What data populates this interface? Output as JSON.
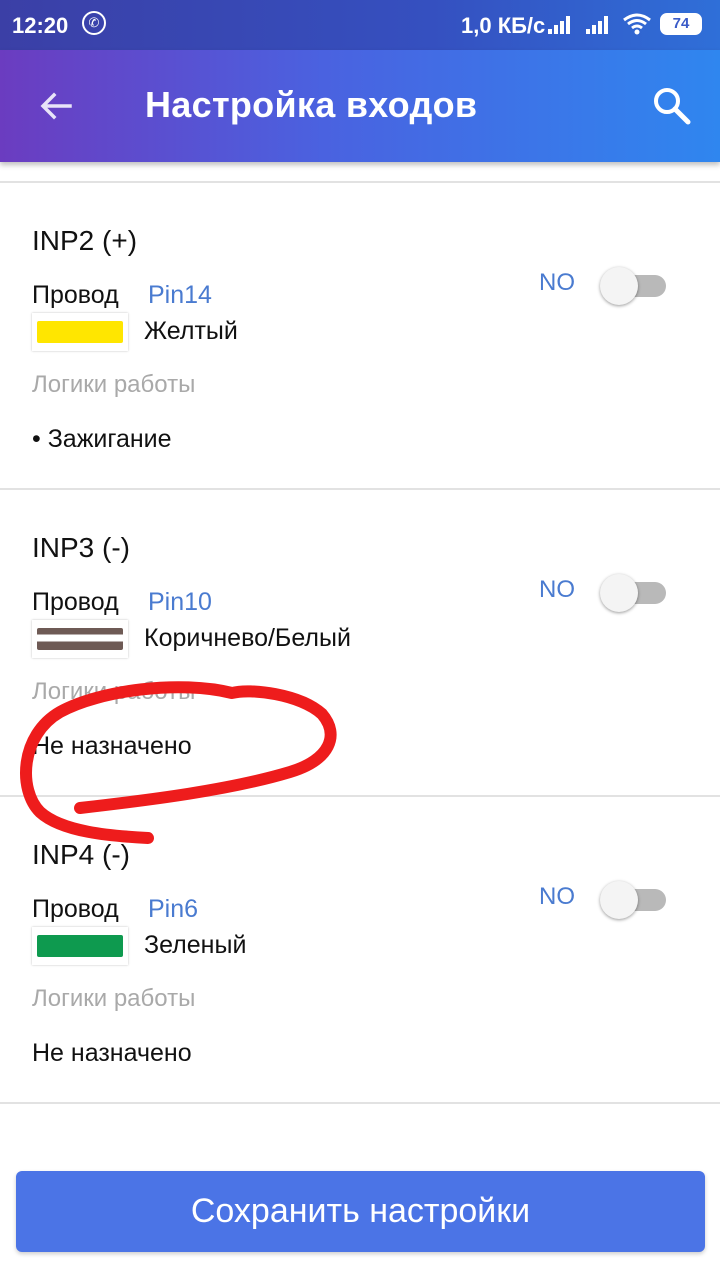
{
  "status_bar": {
    "time": "12:20",
    "network_speed": "1,0 КБ/с",
    "battery": "74",
    "icons": [
      "whatsapp-icon",
      "signal-icon",
      "signal-icon",
      "wifi-icon",
      "battery-icon"
    ]
  },
  "app_bar": {
    "title": "Настройка входов",
    "back_icon": "arrow-back-icon",
    "search_icon": "search-icon",
    "gradient": [
      "#6b3cc0",
      "#2f86ef"
    ]
  },
  "inputs": [
    {
      "title": "INP2 (+)",
      "wire_label": "Провод",
      "pin": "Pin14",
      "color_name": "Желтый",
      "swatch": [
        "#ffe600"
      ],
      "logic_label": "Логики работы",
      "logic_value": "• Зажигание",
      "mode": "NO",
      "enabled": false
    },
    {
      "title": "INP3 (-)",
      "wire_label": "Провод",
      "pin": "Pin10",
      "color_name": "Коричнево/Белый",
      "swatch": [
        "#6e5a55",
        "#ffffff"
      ],
      "logic_label": "Логики работы",
      "logic_value": "Не назначено",
      "mode": "NO",
      "enabled": false
    },
    {
      "title": "INP4 (-)",
      "wire_label": "Провод",
      "pin": "Pin6",
      "color_name": "Зеленый",
      "swatch": [
        "#0e9a4f"
      ],
      "logic_label": "Логики работы",
      "logic_value": "Не назначено",
      "mode": "NO",
      "enabled": false
    }
  ],
  "save_button": {
    "label": "Сохранить настройки",
    "color": "#4b74e6"
  },
  "accent_color": "#4a7bd0",
  "annotation": {
    "type": "red-freehand-circle",
    "color": "#ee1c1c"
  }
}
